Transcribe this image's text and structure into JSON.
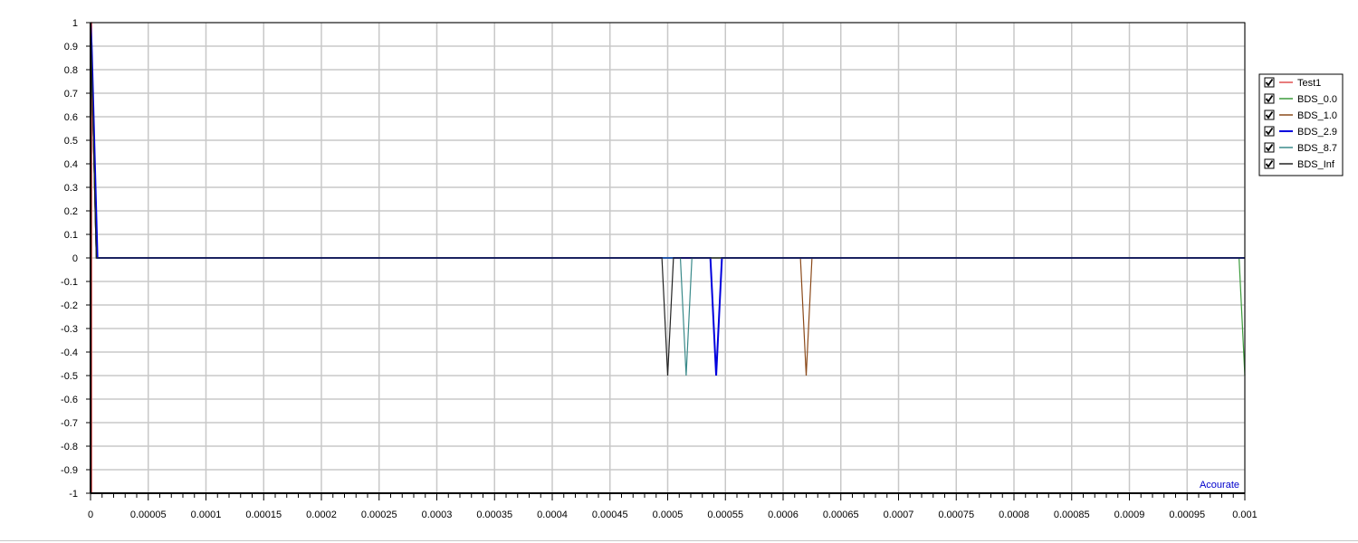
{
  "chart_data": {
    "type": "line",
    "title": "",
    "xlabel": "",
    "ylabel": "",
    "xlim": [
      0,
      0.001
    ],
    "ylim": [
      -1,
      1
    ],
    "grid": true,
    "legend_position": "right",
    "x_tick_labels": [
      "0",
      "0.00005",
      "0.0001",
      "0.00015",
      "0.0002",
      "0.00025",
      "0.0003",
      "0.00035",
      "0.0004",
      "0.00045",
      "0.0005",
      "0.00055",
      "0.0006",
      "0.00065",
      "0.0007",
      "0.00075",
      "0.0008",
      "0.00085",
      "0.0009",
      "0.00095",
      "0.001"
    ],
    "y_tick_labels": [
      "1",
      "0.9",
      "0.8",
      "0.7",
      "0.6",
      "0.5",
      "0.4",
      "0.3",
      "0.2",
      "0.1",
      "0",
      "-0.1",
      "-0.2",
      "-0.3",
      "-0.4",
      "-0.5",
      "-0.6",
      "-0.7",
      "-0.8",
      "-0.9",
      "-1"
    ],
    "x_tick_values": [
      0,
      5e-05,
      0.0001,
      0.00015,
      0.0002,
      0.00025,
      0.0003,
      0.00035,
      0.0004,
      0.00045,
      0.0005,
      0.00055,
      0.0006,
      0.00065,
      0.0007,
      0.00075,
      0.0008,
      0.00085,
      0.0009,
      0.00095,
      0.001
    ],
    "y_tick_values": [
      1,
      0.9,
      0.8,
      0.7,
      0.6,
      0.5,
      0.4,
      0.3,
      0.2,
      0.1,
      0,
      -0.1,
      -0.2,
      -0.3,
      -0.4,
      -0.5,
      -0.6,
      -0.7,
      -0.8,
      -0.9,
      -1
    ],
    "series": [
      {
        "name": "Test1",
        "color": "#e05050",
        "checked": true,
        "x": [
          0,
          5e-07,
          1e-06,
          1e-06
        ],
        "y": [
          -1,
          1,
          1,
          -1
        ]
      },
      {
        "name": "BDS_0.0",
        "color": "#3a9a3a",
        "checked": true,
        "x": [
          0,
          5e-06,
          0.000995,
          0.001
        ],
        "y": [
          1,
          0,
          0,
          -0.5
        ]
      },
      {
        "name": "BDS_1.0",
        "color": "#8b4a1a",
        "checked": true,
        "x": [
          0,
          5e-06,
          0.000615,
          0.00062,
          0.000625,
          0.001
        ],
        "y": [
          1,
          0,
          0,
          -0.5,
          0,
          0
        ]
      },
      {
        "name": "BDS_2.9",
        "color": "#0000dd",
        "checked": true,
        "x": [
          0,
          1e-06,
          6e-06,
          0.000537,
          0.000542,
          0.000547,
          0.001
        ],
        "y": [
          1,
          0.9,
          0,
          0,
          -0.5,
          0,
          0
        ]
      },
      {
        "name": "BDS_8.7",
        "color": "#3a8a8a",
        "checked": true,
        "x": [
          0,
          5e-06,
          0.000511,
          0.000516,
          0.000521,
          0.001
        ],
        "y": [
          1,
          0,
          0,
          -0.5,
          0,
          0
        ]
      },
      {
        "name": "BDS_Inf",
        "color": "#222222",
        "checked": true,
        "x": [
          0,
          5e-06,
          0.000495,
          0.0005,
          0.000505,
          0.001
        ],
        "y": [
          1,
          0,
          0,
          -0.5,
          0,
          0
        ]
      }
    ],
    "annotation": "Acourate"
  }
}
